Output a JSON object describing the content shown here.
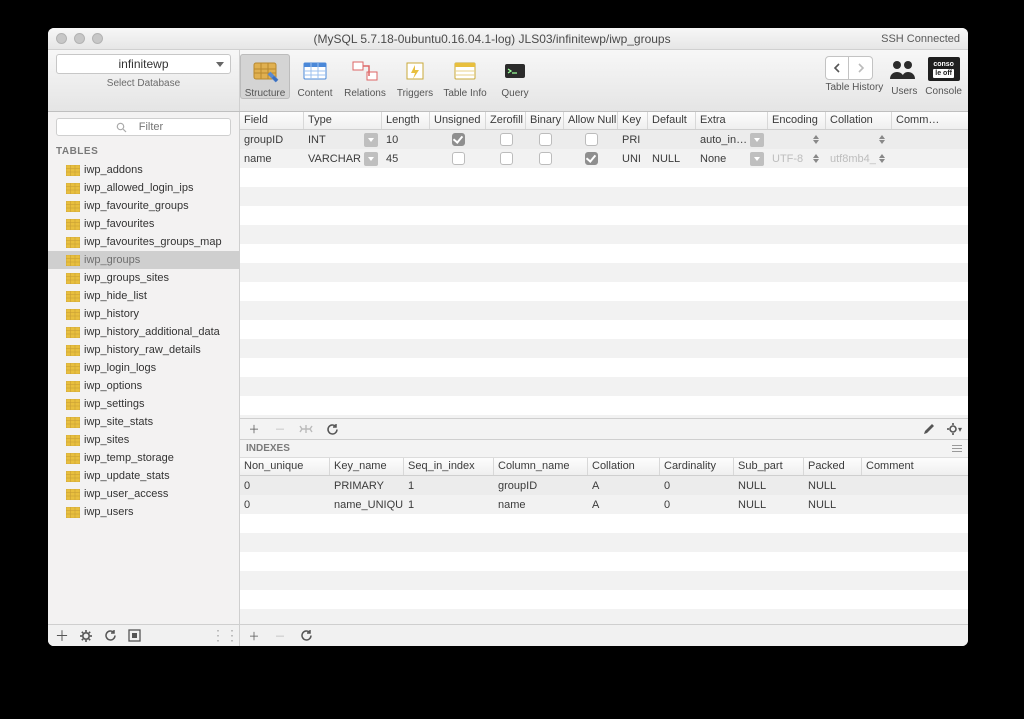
{
  "titlebar": {
    "title": "(MySQL 5.7.18-0ubuntu0.16.04.1-log) JLS03/infinitewp/iwp_groups",
    "status": "SSH Connected"
  },
  "toolbar": {
    "db_selected": "infinitewp",
    "select_db_label": "Select Database",
    "tools": [
      {
        "id": "structure",
        "label": "Structure",
        "selected": true
      },
      {
        "id": "content",
        "label": "Content"
      },
      {
        "id": "relations",
        "label": "Relations"
      },
      {
        "id": "triggers",
        "label": "Triggers"
      },
      {
        "id": "table-info",
        "label": "Table Info"
      },
      {
        "id": "query",
        "label": "Query"
      }
    ],
    "right": {
      "history": "Table History",
      "users": "Users",
      "console": "Console",
      "console_badge_top": "conso",
      "console_badge_bot": "le off"
    }
  },
  "sidebar": {
    "filter_placeholder": "Filter",
    "section": "TABLES",
    "tables": [
      "iwp_addons",
      "iwp_allowed_login_ips",
      "iwp_favourite_groups",
      "iwp_favourites",
      "iwp_favourites_groups_map",
      "iwp_groups",
      "iwp_groups_sites",
      "iwp_hide_list",
      "iwp_history",
      "iwp_history_additional_data",
      "iwp_history_raw_details",
      "iwp_login_logs",
      "iwp_options",
      "iwp_settings",
      "iwp_site_stats",
      "iwp_sites",
      "iwp_temp_storage",
      "iwp_update_stats",
      "iwp_user_access",
      "iwp_users"
    ],
    "selected": "iwp_groups"
  },
  "structure": {
    "headers": [
      "Field",
      "Type",
      "Length",
      "Unsigned",
      "Zerofill",
      "Binary",
      "Allow Null",
      "Key",
      "Default",
      "Extra",
      "Encoding",
      "Collation",
      "Comm…"
    ],
    "rows": [
      {
        "field": "groupID",
        "type": "INT",
        "length": "10",
        "unsigned": true,
        "zerofill": false,
        "binary": false,
        "allow_null": false,
        "key": "PRI",
        "default": "",
        "extra": "auto_in…",
        "encoding": "",
        "collation": "",
        "has_text": false
      },
      {
        "field": "name",
        "type": "VARCHAR",
        "length": "45",
        "unsigned": false,
        "zerofill": false,
        "binary": false,
        "allow_null": true,
        "key": "UNI",
        "default": "NULL",
        "extra": "None",
        "encoding": "UTF-8",
        "collation": "utf8mb4_",
        "has_text": true
      }
    ]
  },
  "indexes": {
    "title": "INDEXES",
    "headers": [
      "Non_unique",
      "Key_name",
      "Seq_in_index",
      "Column_name",
      "Collation",
      "Cardinality",
      "Sub_part",
      "Packed",
      "Comment"
    ],
    "rows": [
      {
        "non_unique": "0",
        "key_name": "PRIMARY",
        "seq": "1",
        "col": "groupID",
        "coll": "A",
        "card": "0",
        "sub": "NULL",
        "packed": "NULL",
        "comm": ""
      },
      {
        "non_unique": "0",
        "key_name": "name_UNIQUE",
        "seq": "1",
        "col": "name",
        "coll": "A",
        "card": "0",
        "sub": "NULL",
        "packed": "NULL",
        "comm": ""
      }
    ]
  }
}
